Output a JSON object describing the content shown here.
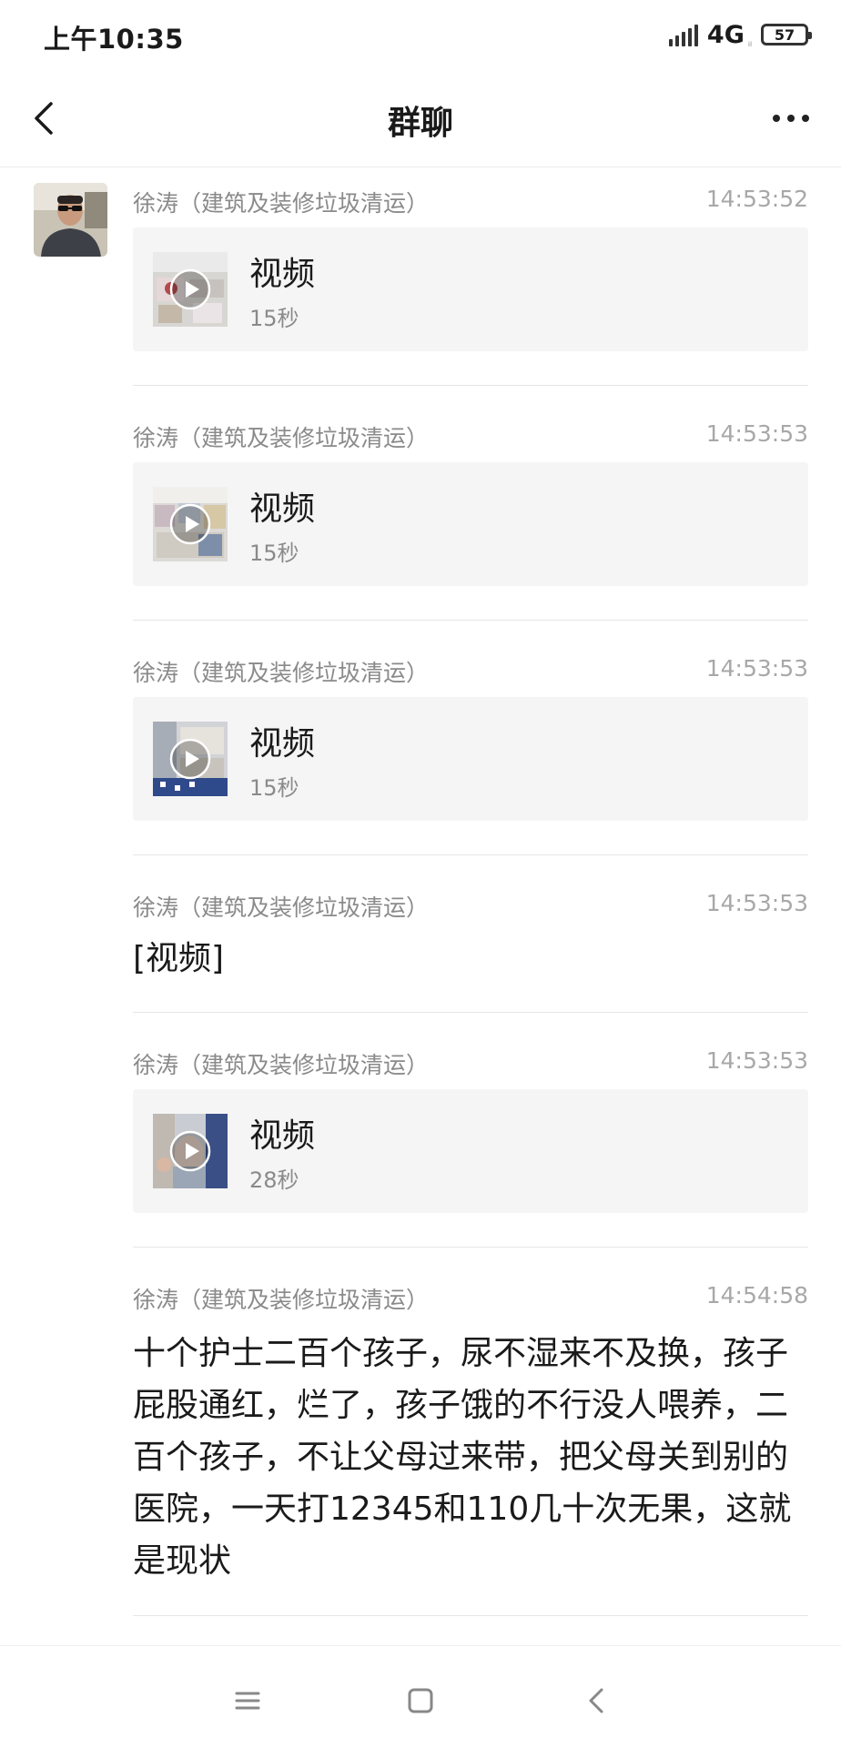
{
  "status_bar": {
    "time": "上午10:35",
    "network": "4G",
    "network_sub": "ᵢₗ",
    "battery": "57"
  },
  "header": {
    "title": "群聊"
  },
  "icons": {
    "back": "chevron-left-icon",
    "more": "more-horizontal-icon",
    "play": "play-circle-icon",
    "menu": "menu-icon",
    "home": "square-home-icon",
    "nav_back": "chevron-left-icon"
  },
  "messages": [
    {
      "sender": "徐涛（建筑及装修垃圾清运）",
      "time": "14:53:52",
      "type": "video",
      "label": "视频",
      "duration": "15秒"
    },
    {
      "sender": "徐涛（建筑及装修垃圾清运）",
      "time": "14:53:53",
      "type": "video",
      "label": "视频",
      "duration": "15秒"
    },
    {
      "sender": "徐涛（建筑及装修垃圾清运）",
      "time": "14:53:53",
      "type": "video",
      "label": "视频",
      "duration": "15秒"
    },
    {
      "sender": "徐涛（建筑及装修垃圾清运）",
      "time": "14:53:53",
      "type": "text",
      "text": "[视频]"
    },
    {
      "sender": "徐涛（建筑及装修垃圾清运）",
      "time": "14:53:53",
      "type": "video",
      "label": "视频",
      "duration": "28秒"
    },
    {
      "sender": "徐涛（建筑及装修垃圾清运）",
      "time": "14:54:58",
      "type": "text",
      "text": "十个护士二百个孩子，尿不湿来不及换，孩子屁股通红，烂了，孩子饿的不行没人喂养，二百个孩子，不让父母过来带，把父母关到别的医院，一天打12345和110几十次无果，这就是现状"
    }
  ]
}
